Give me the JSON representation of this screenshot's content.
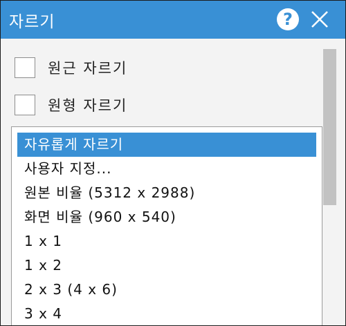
{
  "window": {
    "title": "자르기",
    "help_label": "?"
  },
  "options": [
    {
      "label": "원근 자르기",
      "checked": false
    },
    {
      "label": "원형 자르기",
      "checked": false
    }
  ],
  "ratio_list": {
    "items": [
      {
        "label": "자유롭게 자르기",
        "selected": true
      },
      {
        "label": "사용자 지정...",
        "selected": false
      },
      {
        "label": "원본 비율 (5312 x 2988)",
        "selected": false
      },
      {
        "label": "화면 비율 (960 x 540)",
        "selected": false
      },
      {
        "label": "1 x 1",
        "selected": false
      },
      {
        "label": "1 x 2",
        "selected": false
      },
      {
        "label": "2 x 3 (4 x 6)",
        "selected": false
      },
      {
        "label": "3 x 4",
        "selected": false
      }
    ]
  },
  "colors": {
    "accent": "#3990d5",
    "background": "#f3f3f3",
    "scrollbar_thumb": "#c2c2c2"
  },
  "icons": {
    "help": "question-circle-icon",
    "close": "close-x-icon"
  }
}
